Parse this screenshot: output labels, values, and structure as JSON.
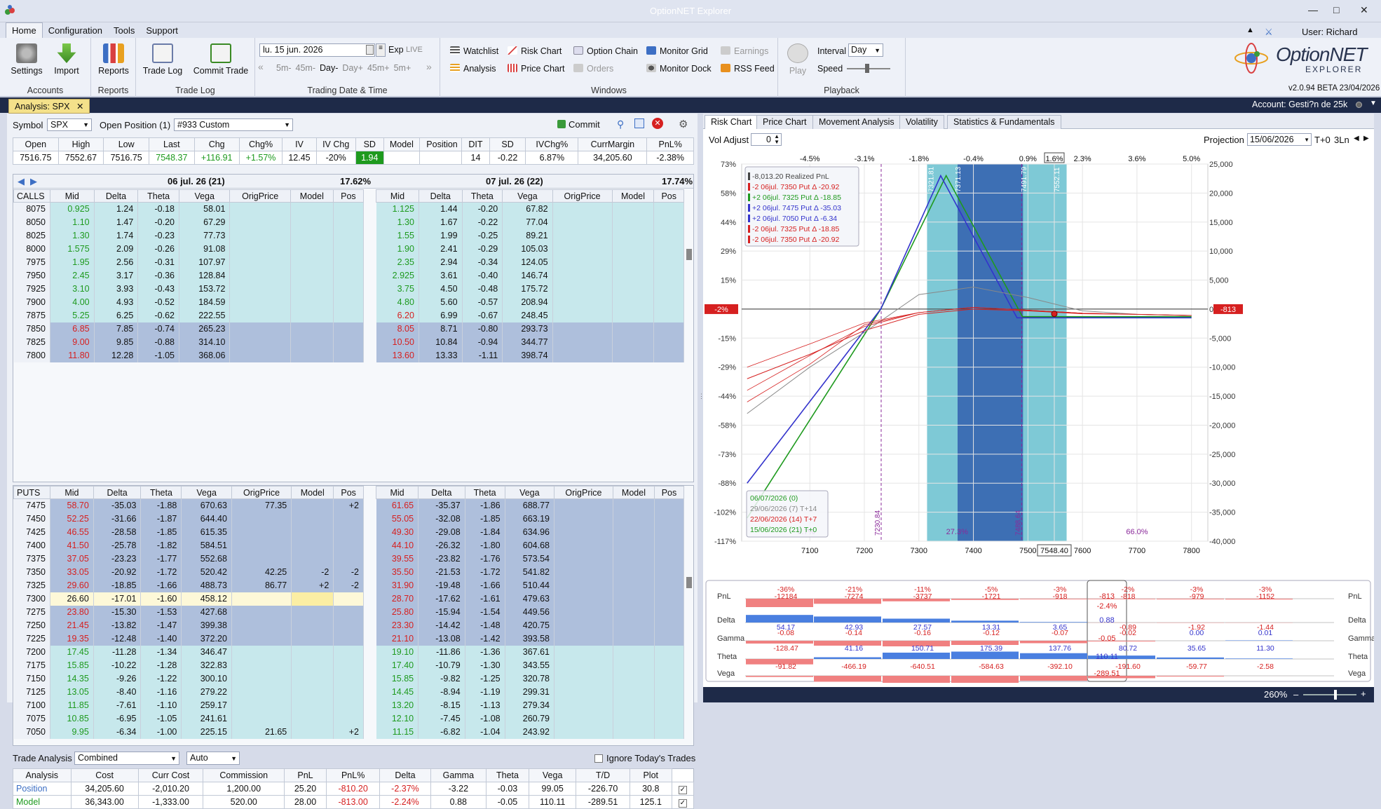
{
  "window": {
    "title": "OptionNET Explorer"
  },
  "menu": [
    "Home",
    "Configuration",
    "Tools",
    "Support"
  ],
  "user": "User: Richard Saenz",
  "ribbon": {
    "accounts": {
      "settings": "Settings",
      "import": "Import",
      "label": "Accounts"
    },
    "reports": {
      "reports": "Reports",
      "label": "Reports"
    },
    "tradelog": {
      "tradelog": "Trade Log",
      "commit": "Commit Trade",
      "label": "Trade Log"
    },
    "datetime": {
      "date": "lu. 15 jun. 2026",
      "exp": "Exp",
      "live": "LIVE",
      "steps": [
        "5m-",
        "45m-",
        "Day-",
        "Day+",
        "45m+",
        "5m+"
      ],
      "label": "Trading Date & Time"
    },
    "windows": {
      "items": [
        "Watchlist",
        "Risk Chart",
        "Option Chain",
        "Monitor Grid",
        "Earnings",
        "Analysis",
        "Price Chart",
        "Orders",
        "Monitor Dock",
        "RSS Feed"
      ],
      "label": "Windows"
    },
    "playback": {
      "play": "Play",
      "interval_label": "Interval",
      "interval": "Day",
      "speed_label": "Speed",
      "label": "Playback"
    },
    "brand": {
      "name": "OptionNET",
      "sub": "EXPLORER",
      "version": "v2.0.94 BETA 23/04/2026"
    }
  },
  "tabs": {
    "analysis": "Analysis: SPX",
    "account": "Account: Gesti?n de 25k"
  },
  "symbolbar": {
    "symbol_label": "Symbol",
    "symbol": "SPX",
    "openpos_label": "Open Position (1)",
    "position": "#933 Custom",
    "commit": "Commit"
  },
  "quote": {
    "headers": [
      "Open",
      "High",
      "Low",
      "Last",
      "Chg",
      "Chg%",
      "IV",
      "IV Chg",
      "SD",
      "Model",
      "Position"
    ],
    "values": [
      "7516.75",
      "7552.67",
      "7516.75",
      "7548.37",
      "+116.91",
      "+1.57%",
      "12.45",
      "-20%",
      "1.94",
      "",
      ""
    ]
  },
  "quote2": {
    "headers": [
      "DIT",
      "SD",
      "IVChg%",
      "CurrMargin",
      "PnL%"
    ],
    "values": [
      "14",
      "-0.22",
      "6.87%",
      "34,205.60",
      "-2.38%"
    ]
  },
  "chain": {
    "exp1": {
      "title": "06 jul. 26 (21)",
      "iv": "17.62%"
    },
    "exp2": {
      "title": "07 jul. 26 (22)",
      "iv": "17.74%"
    },
    "cols": [
      "Mid",
      "Delta",
      "Theta",
      "Vega",
      "OrigPrice",
      "Model",
      "Pos"
    ],
    "calls_label": "CALLS",
    "puts_label": "PUTS",
    "calls": [
      [
        "8075",
        "0.925",
        "1.24",
        "-0.18",
        "58.01",
        "1.125",
        "1.44",
        "-0.20",
        "67.82"
      ],
      [
        "8050",
        "1.10",
        "1.47",
        "-0.20",
        "67.29",
        "1.30",
        "1.67",
        "-0.22",
        "77.04"
      ],
      [
        "8025",
        "1.30",
        "1.74",
        "-0.23",
        "77.73",
        "1.55",
        "1.99",
        "-0.25",
        "89.21"
      ],
      [
        "8000",
        "1.575",
        "2.09",
        "-0.26",
        "91.08",
        "1.90",
        "2.41",
        "-0.29",
        "105.03"
      ],
      [
        "7975",
        "1.95",
        "2.56",
        "-0.31",
        "107.97",
        "2.35",
        "2.94",
        "-0.34",
        "124.05"
      ],
      [
        "7950",
        "2.45",
        "3.17",
        "-0.36",
        "128.84",
        "2.925",
        "3.61",
        "-0.40",
        "146.74"
      ],
      [
        "7925",
        "3.10",
        "3.93",
        "-0.43",
        "153.72",
        "3.75",
        "4.50",
        "-0.48",
        "175.72"
      ],
      [
        "7900",
        "4.00",
        "4.93",
        "-0.52",
        "184.59",
        "4.80",
        "5.60",
        "-0.57",
        "208.94"
      ],
      [
        "7875",
        "5.25",
        "6.25",
        "-0.62",
        "222.55",
        "6.20",
        "6.99",
        "-0.67",
        "248.45"
      ],
      [
        "7850",
        "6.85",
        "7.85",
        "-0.74",
        "265.23",
        "8.05",
        "8.71",
        "-0.80",
        "293.73"
      ],
      [
        "7825",
        "9.00",
        "9.85",
        "-0.88",
        "314.10",
        "10.50",
        "10.84",
        "-0.94",
        "344.77"
      ],
      [
        "7800",
        "11.80",
        "12.28",
        "-1.05",
        "368.06",
        "13.60",
        "13.33",
        "-1.11",
        "398.74"
      ]
    ],
    "calls_otm_from": 9,
    "puts": [
      [
        "7475",
        "58.70",
        "-35.03",
        "-1.88",
        "670.63",
        "77.35",
        "",
        "+2",
        "61.65",
        "-35.37",
        "-1.86",
        "688.77"
      ],
      [
        "7450",
        "52.25",
        "-31.66",
        "-1.87",
        "644.40",
        "",
        "",
        "",
        "55.05",
        "-32.08",
        "-1.85",
        "663.19"
      ],
      [
        "7425",
        "46.55",
        "-28.58",
        "-1.85",
        "615.35",
        "",
        "",
        "",
        "49.30",
        "-29.08",
        "-1.84",
        "634.96"
      ],
      [
        "7400",
        "41.50",
        "-25.78",
        "-1.82",
        "584.51",
        "",
        "",
        "",
        "44.10",
        "-26.32",
        "-1.80",
        "604.68"
      ],
      [
        "7375",
        "37.05",
        "-23.23",
        "-1.77",
        "552.68",
        "",
        "",
        "",
        "39.55",
        "-23.82",
        "-1.76",
        "573.54"
      ],
      [
        "7350",
        "33.05",
        "-20.92",
        "-1.72",
        "520.42",
        "42.25",
        "-2",
        "-2",
        "35.50",
        "-21.53",
        "-1.72",
        "541.82"
      ],
      [
        "7325",
        "29.60",
        "-18.85",
        "-1.66",
        "488.73",
        "86.77",
        "+2",
        "-2",
        "31.90",
        "-19.48",
        "-1.66",
        "510.44"
      ],
      [
        "7300",
        "26.60",
        "-17.01",
        "-1.60",
        "458.12",
        "",
        "",
        "",
        "28.70",
        "-17.62",
        "-1.61",
        "479.63"
      ],
      [
        "7275",
        "23.80",
        "-15.30",
        "-1.53",
        "427.68",
        "",
        "",
        "",
        "25.80",
        "-15.94",
        "-1.54",
        "449.56"
      ],
      [
        "7250",
        "21.45",
        "-13.82",
        "-1.47",
        "399.38",
        "",
        "",
        "",
        "23.30",
        "-14.42",
        "-1.48",
        "420.75"
      ],
      [
        "7225",
        "19.35",
        "-12.48",
        "-1.40",
        "372.20",
        "",
        "",
        "",
        "21.10",
        "-13.08",
        "-1.42",
        "393.58"
      ],
      [
        "7200",
        "17.45",
        "-11.28",
        "-1.34",
        "346.47",
        "",
        "",
        "",
        "19.10",
        "-11.86",
        "-1.36",
        "367.61"
      ],
      [
        "7175",
        "15.85",
        "-10.22",
        "-1.28",
        "322.83",
        "",
        "",
        "",
        "17.40",
        "-10.79",
        "-1.30",
        "343.55"
      ],
      [
        "7150",
        "14.35",
        "-9.26",
        "-1.22",
        "300.10",
        "",
        "",
        "",
        "15.85",
        "-9.82",
        "-1.25",
        "320.78"
      ],
      [
        "7125",
        "13.05",
        "-8.40",
        "-1.16",
        "279.22",
        "",
        "",
        "",
        "14.45",
        "-8.94",
        "-1.19",
        "299.31"
      ],
      [
        "7100",
        "11.85",
        "-7.61",
        "-1.10",
        "259.17",
        "",
        "",
        "",
        "13.20",
        "-8.15",
        "-1.13",
        "279.34"
      ],
      [
        "7075",
        "10.85",
        "-6.95",
        "-1.05",
        "241.61",
        "",
        "",
        "",
        "12.10",
        "-7.45",
        "-1.08",
        "260.79"
      ],
      [
        "7050",
        "9.95",
        "-6.34",
        "-1.00",
        "225.15",
        "21.65",
        "",
        "+2",
        "11.15",
        "-6.82",
        "-1.04",
        "243.92"
      ]
    ],
    "puts_itm_until": 11
  },
  "trade": {
    "label": "Trade Analysis",
    "mode": "Combined",
    "auto": "Auto",
    "ignore": "Ignore Today's Trades",
    "headers": [
      "Analysis",
      "Cost",
      "Curr Cost",
      "Commission",
      "PnL",
      "PnL%",
      "Delta",
      "Gamma",
      "Theta",
      "Vega",
      "T/D",
      "Plot"
    ],
    "rows": [
      [
        "Position",
        "34,205.60",
        "-2,010.20",
        "1,200.00",
        "25.20",
        "-810.20",
        "-2.37%",
        "-3.22",
        "-0.03",
        "99.05",
        "-226.70",
        "30.8"
      ],
      [
        "Model",
        "36,343.00",
        "-1,333.00",
        "520.00",
        "28.00",
        "-813.00",
        "-2.24%",
        "0.88",
        "-0.05",
        "110.11",
        "-289.51",
        "125.1"
      ]
    ]
  },
  "right": {
    "tabs": [
      "Risk Chart",
      "Price Chart",
      "Movement Analysis",
      "Volatility",
      "Statistics & Fundamentals"
    ],
    "voladj_label": "Vol Adjust",
    "voladj": "0",
    "proj_label": "Projection",
    "proj": "15/06/2026",
    "t0": "T+0",
    "ln": "3Ln",
    "zoom": "260%"
  },
  "chart_data": {
    "type": "line",
    "x_ticks": [
      "7100",
      "7200",
      "7300",
      "7400",
      "7500",
      "7548.40",
      "7600",
      "7700",
      "7800"
    ],
    "x_range": [
      6975,
      7830
    ],
    "pct_ticks": [
      "-4.5%",
      "-3.1%",
      "-1.8%",
      "-0.4%",
      "0.9%",
      "1.6%",
      "2.3%",
      "3.6%",
      "5.0%"
    ],
    "y_left_ticks": [
      "73%",
      "58%",
      "44%",
      "29%",
      "15%",
      "0%",
      "-15%",
      "-29%",
      "-44%",
      "-58%",
      "-73%",
      "-88%",
      "-102%",
      "-117%"
    ],
    "y_right_ticks": [
      "25,000",
      "20,000",
      "15,000",
      "10,000",
      "5,000",
      "0",
      "-5,000",
      "-10,000",
      "-15,000",
      "-20,000",
      "-25,000",
      "-30,000",
      "-35,000",
      "-40,000"
    ],
    "y_range": [
      -40000,
      25000
    ],
    "vlines": [
      {
        "x": 7230.84,
        "label": "7230.84"
      },
      {
        "x": 7488.64,
        "label": "7488.64"
      }
    ],
    "bands": [
      {
        "from": 7315,
        "to": 7571,
        "label": "27.3%",
        "color": "#7ec9d6"
      },
      {
        "from": 7371,
        "to": 7491,
        "label": "",
        "color": "#3d6fb4"
      }
    ],
    "band_top_labels": [
      "7321.81",
      "7371.13",
      "7491.79",
      "7552.11"
    ],
    "band_pct": {
      "left": "6.7%",
      "mid": "27.3%",
      "right": "66.0%"
    },
    "current_pnl": "-813",
    "current_pct": "-2%",
    "legend": [
      {
        "t": "-8,013.20 Realized PnL",
        "c": "#444"
      },
      {
        "t": "-2 06jul. 7350 Put Δ -20.92",
        "c": "#d62020"
      },
      {
        "t": "+2 06jul. 7325 Put Δ -18.85",
        "c": "#1e9a1e"
      },
      {
        "t": "+2 06jul. 7475 Put Δ -35.03",
        "c": "#3333cc"
      },
      {
        "t": "+2 06jul. 7050 Put Δ -6.34",
        "c": "#3333cc"
      },
      {
        "t": "-2 06jul. 7325 Put Δ -18.85",
        "c": "#d62020"
      },
      {
        "t": "-2 06jul. 7350 Put Δ -20.92",
        "c": "#d62020"
      }
    ],
    "dates": [
      {
        "t": "06/07/2026 (0)",
        "c": "#1e9a1e"
      },
      {
        "t": "29/06/2026 (7) T+14",
        "c": "#888"
      },
      {
        "t": "22/06/2026 (14) T+7",
        "c": "#d62020"
      },
      {
        "t": "15/06/2026 (21) T+0",
        "c": "#1e9a1e"
      }
    ],
    "series": [
      {
        "name": "06/07/2026 (0)",
        "color": "#1e9a1e",
        "x": [
          6985,
          7230,
          7350,
          7490,
          7800
        ],
        "y": [
          -36000,
          0,
          23000,
          -1300,
          -1300
        ]
      },
      {
        "name": "T+0 blue",
        "color": "#3333cc",
        "x": [
          6985,
          7230,
          7340,
          7480,
          7800
        ],
        "y": [
          -30000,
          0,
          23000,
          -1500,
          -1500
        ]
      },
      {
        "name": "T+7",
        "color": "#d62020",
        "x": [
          6985,
          7100,
          7200,
          7300,
          7400,
          7500,
          7600,
          7700,
          7800
        ],
        "y": [
          -12000,
          -7800,
          -3700,
          -900,
          0,
          -300,
          -800,
          -900,
          -1100
        ]
      },
      {
        "name": "T+14",
        "color": "#888",
        "x": [
          6985,
          7100,
          7200,
          7300,
          7400,
          7500,
          7600,
          7700,
          7800
        ],
        "y": [
          -18000,
          -10000,
          -4000,
          2500,
          3800,
          2000,
          -300,
          -900,
          -1100
        ]
      }
    ]
  },
  "greeks": {
    "cols_x": [
      "7100",
      "7200",
      "7300",
      "7400",
      "7500",
      "7600",
      "7700",
      "7800"
    ],
    "pnl_pct": [
      "-36%",
      "-21%",
      "-11%",
      "-5%",
      "-3%",
      "-2%",
      "-3%",
      "-3%"
    ],
    "pnl": [
      "-12184",
      "-7274",
      "-3737",
      "-1721",
      "-918",
      "-818",
      "-979",
      "-1152"
    ],
    "pnl_cur": "-813",
    "pnl_cur_pct": "-2.4%",
    "delta": [
      "54.17",
      "42.93",
      "27.57",
      "13.31",
      "3.65",
      "-0.89",
      "-1.92",
      "-1.44"
    ],
    "delta_cur": "0.88",
    "gamma": [
      "-0.08",
      "-0.14",
      "-0.16",
      "-0.12",
      "-0.07",
      "-0.02",
      "0.00",
      "0.01"
    ],
    "gamma_cur": "-0.05",
    "theta": [
      "-128.47",
      "41.16",
      "150.71",
      "175.39",
      "137.76",
      "80.72",
      "35.65",
      "11.30"
    ],
    "theta_cur": "110.11",
    "vega": [
      "-91.82",
      "-466.19",
      "-640.51",
      "-584.63",
      "-392.10",
      "-191.60",
      "-59.77",
      "-2.58"
    ],
    "vega_cur": "-289.51",
    "labels": [
      "PnL",
      "Delta",
      "Gamma",
      "Theta",
      "Vega"
    ]
  }
}
